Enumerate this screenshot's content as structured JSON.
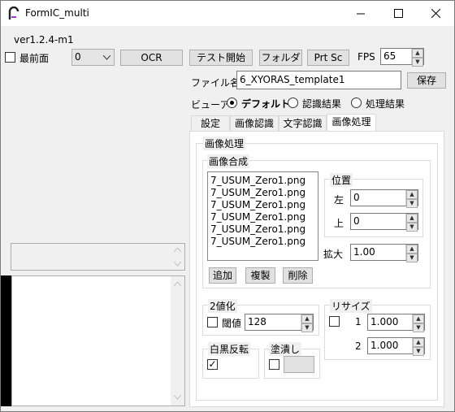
{
  "window": {
    "title": "FormIC_multi",
    "version": "ver1.2.4-m1"
  },
  "toolbar": {
    "topmost_label": "最前面",
    "combo_value": "0",
    "ocr_label": "OCR",
    "test_start_label": "テスト開始",
    "folder_label": "フォルダ",
    "prtsc_label": "Prt Sc",
    "fps_label": "FPS",
    "fps_value": "65"
  },
  "file": {
    "label": "ファイル名",
    "value": "6_XYORAS_template1",
    "save_label": "保存"
  },
  "viewer": {
    "label": "ビューア",
    "options": [
      "デフォルト",
      "認識結果",
      "処理結果"
    ],
    "selected": "デフォルト"
  },
  "tabs": [
    "設定",
    "画像認識",
    "文字認識",
    "画像処理"
  ],
  "active_tab": "画像処理",
  "image_processing": {
    "group_title": "画像処理",
    "compose": {
      "title": "画像合成",
      "items": [
        "7_USUM_Zero1.png",
        "7_USUM_Zero1.png",
        "7_USUM_Zero1.png",
        "7_USUM_Zero1.png",
        "7_USUM_Zero1.png",
        "7_USUM_Zero1.png"
      ],
      "add_label": "追加",
      "duplicate_label": "複製",
      "delete_label": "削除"
    },
    "position": {
      "title": "位置",
      "left_label": "左",
      "left_value": "0",
      "top_label": "上",
      "top_value": "0"
    },
    "scale": {
      "label": "拡大",
      "value": "1.00"
    },
    "binarize": {
      "title": "2値化",
      "threshold_label": "閾値",
      "threshold_value": "128"
    },
    "resize": {
      "title": "リサイズ",
      "label1": "1",
      "value1": "1.000",
      "label2": "2",
      "value2": "1.000"
    },
    "invert": {
      "title": "白黒反転",
      "checked": "✓"
    },
    "fill": {
      "title": "塗潰し"
    }
  }
}
